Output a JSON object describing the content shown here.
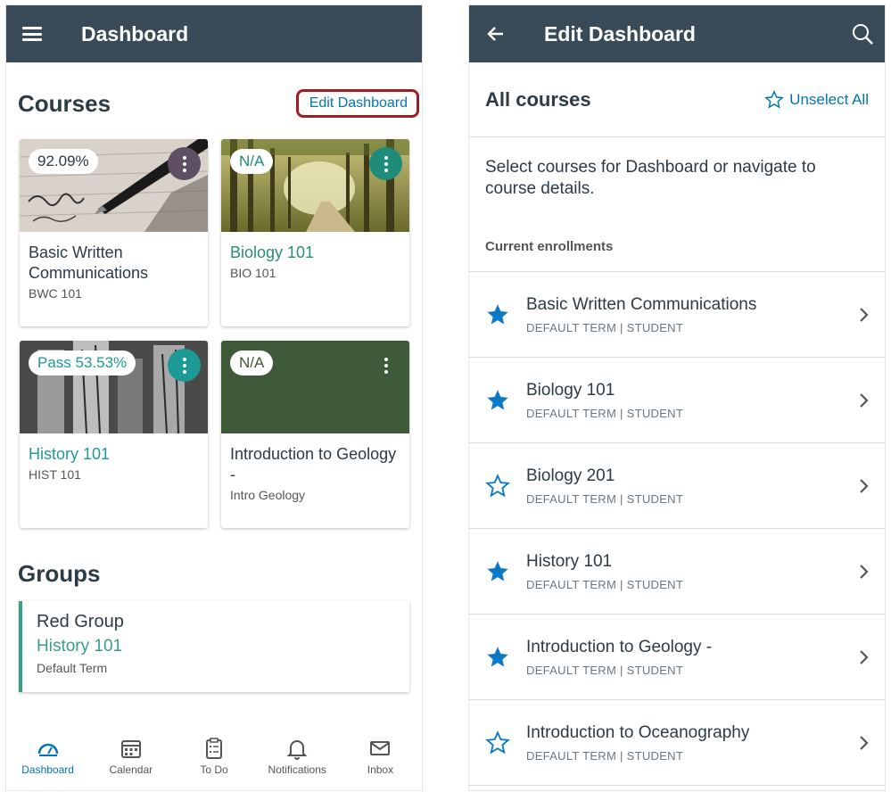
{
  "left": {
    "appbar_title": "Dashboard",
    "courses_title": "Courses",
    "edit_dashboard": "Edit Dashboard",
    "cards": [
      {
        "grade": "92.09%",
        "name": "Basic Written Communications",
        "code": "BWC 101",
        "name_color": "#2d3b45",
        "kebab_color": "#5e4f63"
      },
      {
        "grade": "N/A",
        "name": "Biology 101",
        "code": "BIO 101",
        "name_color": "#2a8c7a",
        "kebab_color": "#1f8c79"
      },
      {
        "grade": "Pass 53.53%",
        "name": "History 101",
        "code": "HIST 101",
        "name_color": "#1f9a96",
        "kebab_color": "#1d9a95"
      },
      {
        "grade": "N/A",
        "name": "Introduction to Geology -",
        "code": "Intro Geology",
        "name_color": "#2d3b45",
        "kebab_color": "#3f5a38"
      }
    ],
    "groups_title": "Groups",
    "group": {
      "name": "Red Group",
      "course": "History 101",
      "term": "Default Term"
    },
    "nav": [
      {
        "label": "Dashboard",
        "icon": "dashboard-icon"
      },
      {
        "label": "Calendar",
        "icon": "calendar-icon"
      },
      {
        "label": "To Do",
        "icon": "todo-icon"
      },
      {
        "label": "Notifications",
        "icon": "bell-icon"
      },
      {
        "label": "Inbox",
        "icon": "mail-icon"
      }
    ]
  },
  "right": {
    "appbar_title": "Edit Dashboard",
    "all_courses": "All courses",
    "unselect_all": "Unselect All",
    "description": "Select courses for Dashboard or navigate to course details.",
    "enrollments_label": "Current enrollments",
    "courses": [
      {
        "name": "Basic Written Communications",
        "term": "DEFAULT TERM | STUDENT",
        "starred": true
      },
      {
        "name": "Biology 101",
        "term": "DEFAULT TERM | STUDENT",
        "starred": true
      },
      {
        "name": "Biology 201",
        "term": "DEFAULT TERM | STUDENT",
        "starred": false
      },
      {
        "name": "History 101",
        "term": "DEFAULT TERM | STUDENT",
        "starred": true
      },
      {
        "name": "Introduction to Geology -",
        "term": "DEFAULT TERM | STUDENT",
        "starred": true
      },
      {
        "name": "Introduction to Oceanography",
        "term": "DEFAULT TERM | STUDENT",
        "starred": false
      }
    ]
  },
  "colors": {
    "appbar": "#394b58",
    "accent": "#0374b5",
    "highlight_border": "#a01e22"
  }
}
